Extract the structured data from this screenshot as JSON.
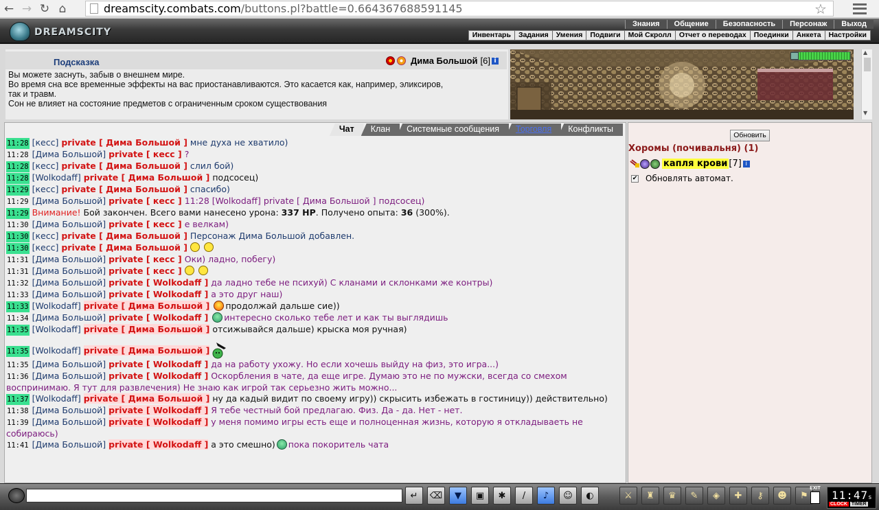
{
  "browser": {
    "url_host": "dreamscity.combats.com",
    "url_path": "/buttons.pl?battle=0.664367688591145"
  },
  "header": {
    "logo_text": "DREAMSCITY",
    "top_menu": [
      "Знания",
      "Общение",
      "Безопасность",
      "Персонаж",
      "Выход"
    ],
    "sub_menu": [
      "Инвентарь",
      "Задания",
      "Умения",
      "Подвиги",
      "Мой Скролл",
      "Отчет о переводах",
      "Поединки",
      "Анкета",
      "Настройки"
    ]
  },
  "hint": {
    "title": "Подсказка",
    "player_name": "Дима Большой",
    "player_level": "[6]",
    "lines": [
      "Вы можете заснуть, забыв о внешнем мире.",
      "Во время сна все временные эффекты на вас приостанавливаются. Это касается как, например, эликсиров,",
      "так и травм.",
      "Сон не влияет на состояние предметов с ограниченным сроком существования"
    ]
  },
  "status": {
    "hp_fraction": 1.0
  },
  "chat": {
    "tabs": [
      "Чат",
      "Клан",
      "Системные сообщения",
      "Торговля",
      "Конфликты"
    ],
    "messages": [
      {
        "time": "11:28",
        "hl": true,
        "from": "[кесс]",
        "priv": "private [ Дима Большой ]",
        "pink": false,
        "text": "мне духа не хватило)",
        "tc": "txt-blue"
      },
      {
        "time": "11:28",
        "hl": false,
        "from": "[Дима Большой]",
        "priv": "private [ кесс ]",
        "pink": false,
        "text": "?",
        "tc": "txt-purple"
      },
      {
        "time": "11:28",
        "hl": true,
        "from": "[кесс]",
        "priv": "private [ Дима Большой ]",
        "pink": false,
        "text": "слил бой)",
        "tc": "txt-blue"
      },
      {
        "time": "11:28",
        "hl": true,
        "from": "[Wolkodaff]",
        "priv": "private [ Дима Большой ]",
        "pink": false,
        "text": "подсосец)",
        "tc": "txt-black"
      },
      {
        "time": "11:29",
        "hl": true,
        "from": "[кесс]",
        "priv": "private [ Дима Большой ]",
        "pink": false,
        "text": "спасибо)",
        "tc": "txt-blue"
      },
      {
        "time": "11:29",
        "hl": false,
        "from": "[Дима Большой]",
        "priv": "private [ кесс ]",
        "pink": false,
        "text": "11:28 [Wolkodaff] private [ Дима Большой ] подсосец)",
        "tc": "txt-purple"
      },
      {
        "time": "11:29",
        "hl": true,
        "warn": "Внимание!",
        "text": "Бой закончен. Всего вами нанесено урона: ",
        "dmg": "337 HP",
        "text2": ". Получено опыта: ",
        "exp": "36",
        "text3": " (300%)."
      },
      {
        "time": "11:30",
        "hl": false,
        "from": "[Дима Большой]",
        "priv": "private [ кесс ]",
        "pink": false,
        "text": "е велкам)",
        "tc": "txt-purple"
      },
      {
        "time": "11:30",
        "hl": true,
        "from": "[кесс]",
        "priv": "private [ Дима Большой ]",
        "pink": false,
        "text": "Персонаж Дима Большой добавлен.",
        "tc": "txt-blue"
      },
      {
        "time": "11:30",
        "hl": true,
        "from": "[кесс]",
        "priv": "private [ Дима Большой ]",
        "pink": false,
        "text": "",
        "tc": "txt-blue",
        "smile": "pac"
      },
      {
        "time": "11:31",
        "hl": false,
        "from": "[Дима Большой]",
        "priv": "private [ кесс ]",
        "pink": false,
        "text": "Оки) ладно, побегу)",
        "tc": "txt-purple"
      },
      {
        "time": "11:31",
        "hl": false,
        "from": "[Дима Большой]",
        "priv": "private [ кесс ]",
        "pink": false,
        "text": "",
        "tc": "txt-purple",
        "smile": "pac"
      },
      {
        "time": "11:32",
        "hl": false,
        "from": "[Дима Большой]",
        "priv": "private [ Wolkodaff ]",
        "pink": false,
        "text": "да ладно тебе не психуй) С кланами и склонками же контры)",
        "tc": "txt-purple"
      },
      {
        "time": "11:33",
        "hl": false,
        "from": "[Дима Большой]",
        "priv": "private [ Wolkodaff ]",
        "pink": false,
        "text": "а это друг наш)",
        "tc": "txt-purple"
      },
      {
        "time": "11:33",
        "hl": true,
        "from": "[Wolkodaff]",
        "priv": "private [ Дима Большой ]",
        "pink": true,
        "text": "продолжай дальше сие))",
        "tc": "txt-black",
        "smile": "red"
      },
      {
        "time": "11:34",
        "hl": false,
        "from": "[Дима Большой]",
        "priv": "private [ Wolkodaff ]",
        "pink": false,
        "text": "интересно сколько тебе лет и как ты выглядишь",
        "tc": "txt-purple",
        "smile": "green"
      },
      {
        "time": "11:35",
        "hl": true,
        "from": "[Wolkodaff]",
        "priv": "private [ Дима Большой ]",
        "pink": true,
        "text": "отсижывайся дальше) крыска моя ручная)",
        "tc": "txt-black"
      },
      {
        "time": "11:35",
        "hl": true,
        "from": "[Wolkodaff]",
        "priv": "private [ Дима Большой ]",
        "pink": true,
        "text": "",
        "tc": "txt-black",
        "smile": "gun"
      },
      {
        "time": "11:35",
        "hl": false,
        "from": "[Дима Большой]",
        "priv": "private [ Wolkodaff ]",
        "pink": false,
        "text": "да на работу ухожу. Но если хочешь выйду на физ, это игра...)",
        "tc": "txt-purple"
      },
      {
        "time": "11:36",
        "hl": false,
        "from": "[Дима Большой]",
        "priv": "private [ Wolkodaff ]",
        "pink": false,
        "text": "Оскорбления в чате, да еще игре. Думаю это не по мужски, всегда со смехом воспринимаю. Я тут для развлечения) Не знаю как игрой так серьезно жить можно...",
        "tc": "txt-purple"
      },
      {
        "time": "11:37",
        "hl": true,
        "from": "[Wolkodaff]",
        "priv": "private [ Дима Большой ]",
        "pink": true,
        "text": "ну да кадый видит по своему игру)) скрысить избежать в гостиницу)) действительно)",
        "tc": "txt-black"
      },
      {
        "time": "11:38",
        "hl": false,
        "from": "[Дима Большой]",
        "priv": "private [ Wolkodaff ]",
        "pink": true,
        "text": "Я тебе честный бой предлагаю. Физ. Да - да. Нет - нет.",
        "tc": "txt-purple"
      },
      {
        "time": "11:39",
        "hl": false,
        "from": "[Дима Большой]",
        "priv": "private [ Wolkodaff ]",
        "pink": true,
        "text": "у меня помимо игры есть еще и полноценная жизнь, которую я откладываеть не собираюсь)",
        "tc": "txt-purple"
      },
      {
        "time": "11:41",
        "hl": false,
        "from": "[Дима Большой]",
        "priv": "private [ Wolkodaff ]",
        "pink": true,
        "text": "а это смешно)",
        "tc": "txt-black",
        "smile_mid": "green",
        "text_after": "пока покоритель чата",
        "tc_after": "txt-purple"
      }
    ]
  },
  "room": {
    "refresh_label": "Обновить",
    "title": "Хоромы (почивальня) (1)",
    "user_name": "капля крови",
    "user_level": "[7]",
    "auto_refresh_label": "Обновлять автомат."
  },
  "toolbar": {
    "input_value": "",
    "clock": "11:47",
    "clock_seconds": "s",
    "clock_label": "CLOCK",
    "timer_label": "TIMER",
    "exit_label": "EXIT"
  }
}
